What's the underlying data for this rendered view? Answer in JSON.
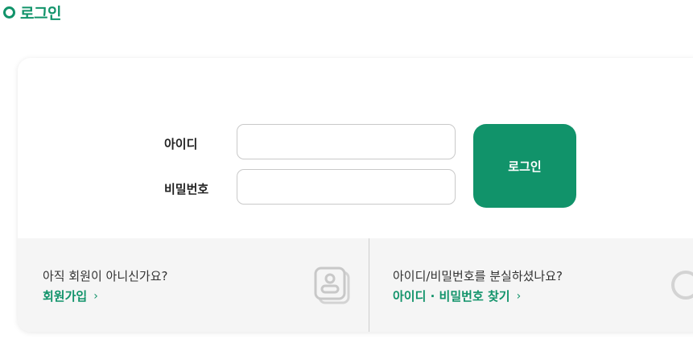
{
  "page": {
    "title": "로그인"
  },
  "form": {
    "id_label": "아이디",
    "password_label": "비밀번호",
    "id_value": "",
    "password_value": "",
    "submit_label": "로그인"
  },
  "signup": {
    "question": "아직 회원이 아니신가요?",
    "link_label": "회원가입",
    "chevron": "›",
    "icon": "member-card-icon"
  },
  "find_account": {
    "question": "아이디/비밀번호를 분실하셨나요?",
    "link_label": "아이디 · 비밀번호 찾기",
    "chevron": "›",
    "icon": "search-icon"
  },
  "colors": {
    "accent": "#11936a",
    "panel_bg": "#f5f5f5"
  }
}
